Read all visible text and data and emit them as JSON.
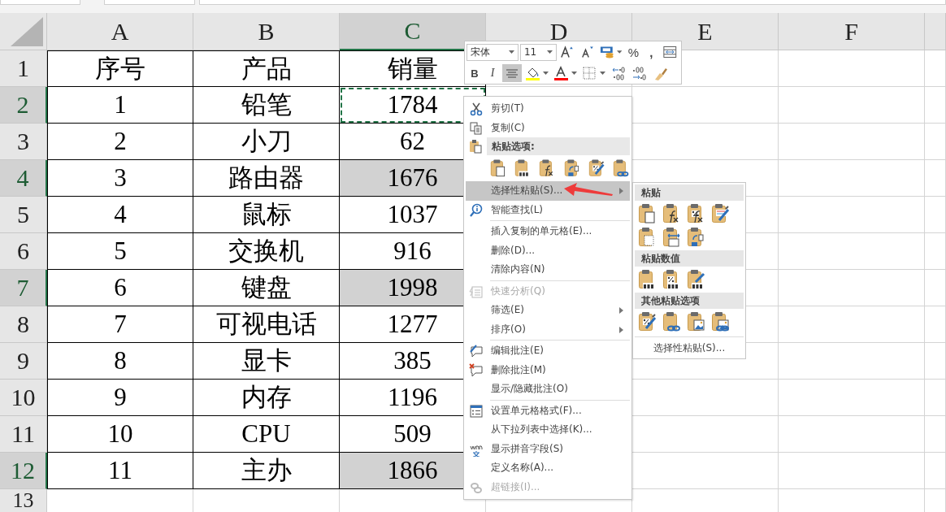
{
  "table": {
    "columns": [
      {
        "label": "A",
        "selected": false
      },
      {
        "label": "B",
        "selected": false
      },
      {
        "label": "C",
        "selected": true
      },
      {
        "label": "D",
        "selected": false
      },
      {
        "label": "E",
        "selected": false
      },
      {
        "label": "F",
        "selected": false
      }
    ],
    "rows": [
      {
        "header": "1",
        "selected": false,
        "cells": [
          {
            "text": "序号",
            "selected": false,
            "copied": false
          },
          {
            "text": "产品",
            "selected": false,
            "copied": false
          },
          {
            "text": "销量",
            "selected": false,
            "copied": false
          }
        ]
      },
      {
        "header": "2",
        "selected": true,
        "cells": [
          {
            "text": "1",
            "selected": false,
            "copied": false
          },
          {
            "text": "铅笔",
            "selected": false,
            "copied": false
          },
          {
            "text": "1784",
            "selected": false,
            "copied": true
          }
        ]
      },
      {
        "header": "3",
        "selected": false,
        "cells": [
          {
            "text": "2",
            "selected": false,
            "copied": false
          },
          {
            "text": "小刀",
            "selected": false,
            "copied": false
          },
          {
            "text": "62",
            "selected": false,
            "copied": false
          }
        ]
      },
      {
        "header": "4",
        "selected": true,
        "cells": [
          {
            "text": "3",
            "selected": false,
            "copied": false
          },
          {
            "text": "路由器",
            "selected": false,
            "copied": false
          },
          {
            "text": "1676",
            "selected": true,
            "copied": false
          }
        ]
      },
      {
        "header": "5",
        "selected": false,
        "cells": [
          {
            "text": "4",
            "selected": false,
            "copied": false
          },
          {
            "text": "鼠标",
            "selected": false,
            "copied": false
          },
          {
            "text": "1037",
            "selected": false,
            "copied": false
          }
        ]
      },
      {
        "header": "6",
        "selected": false,
        "cells": [
          {
            "text": "5",
            "selected": false,
            "copied": false
          },
          {
            "text": "交换机",
            "selected": false,
            "copied": false
          },
          {
            "text": "916",
            "selected": false,
            "copied": false
          }
        ]
      },
      {
        "header": "7",
        "selected": true,
        "cells": [
          {
            "text": "6",
            "selected": false,
            "copied": false
          },
          {
            "text": "键盘",
            "selected": false,
            "copied": false
          },
          {
            "text": "1998",
            "selected": true,
            "copied": false
          }
        ]
      },
      {
        "header": "8",
        "selected": false,
        "cells": [
          {
            "text": "7",
            "selected": false,
            "copied": false
          },
          {
            "text": "可视电话",
            "selected": false,
            "copied": false
          },
          {
            "text": "1277",
            "selected": false,
            "copied": false
          }
        ]
      },
      {
        "header": "9",
        "selected": false,
        "cells": [
          {
            "text": "8",
            "selected": false,
            "copied": false
          },
          {
            "text": "显卡",
            "selected": false,
            "copied": false
          },
          {
            "text": "385",
            "selected": false,
            "copied": false
          }
        ]
      },
      {
        "header": "10",
        "selected": false,
        "cells": [
          {
            "text": "9",
            "selected": false,
            "copied": false
          },
          {
            "text": "内存",
            "selected": false,
            "copied": false
          },
          {
            "text": "1196",
            "selected": false,
            "copied": false
          }
        ]
      },
      {
        "header": "11",
        "selected": false,
        "cells": [
          {
            "text": "10",
            "selected": false,
            "copied": false
          },
          {
            "text": "CPU",
            "selected": false,
            "copied": false
          },
          {
            "text": "509",
            "selected": false,
            "copied": false
          }
        ]
      },
      {
        "header": "12",
        "selected": true,
        "cells": [
          {
            "text": "11",
            "selected": false,
            "copied": false
          },
          {
            "text": "主办",
            "selected": false,
            "copied": false
          },
          {
            "text": "1866",
            "selected": true,
            "copied": false
          }
        ]
      },
      {
        "header": "13",
        "selected": false,
        "cells": []
      }
    ]
  },
  "mini_toolbar": {
    "font": "宋体",
    "size": "11",
    "row_1": [
      {
        "kind": "grow",
        "selected": false
      },
      {
        "kind": "shrink",
        "selected": false
      },
      {
        "kind": "accounting",
        "selected": false
      },
      {
        "kind": "percent",
        "label": "%",
        "selected": false
      },
      {
        "kind": "comma",
        "label": ",",
        "selected": false
      },
      {
        "kind": "merge",
        "selected": false
      }
    ],
    "row_2": [
      {
        "kind": "bold",
        "label": "B",
        "selected": false
      },
      {
        "kind": "italic",
        "label": "I",
        "selected": false
      },
      {
        "kind": "align",
        "selected": true
      },
      {
        "kind": "fill",
        "color": "#ffff00",
        "selected": false
      },
      {
        "kind": "fontcolor",
        "color": "#ff0000",
        "selected": false
      },
      {
        "kind": "borders",
        "selected": false
      },
      {
        "kind": "incdec",
        "selected": false
      },
      {
        "kind": "decdec",
        "selected": false
      },
      {
        "kind": "painter",
        "selected": false
      }
    ]
  },
  "context_menu": {
    "items": [
      {
        "kind": "item",
        "label": "剪切(T)",
        "selected": false,
        "disabled": false,
        "submenu": false
      },
      {
        "kind": "item",
        "label": "复制(C)",
        "selected": false,
        "disabled": false,
        "submenu": false
      },
      {
        "kind": "header",
        "label": "粘贴选项:"
      },
      {
        "kind": "icons",
        "icons": [
          {
            "kind": "paste"
          },
          {
            "kind": "values"
          },
          {
            "kind": "formulas"
          },
          {
            "kind": "transpose"
          },
          {
            "kind": "percent_brush"
          },
          {
            "kind": "link"
          }
        ]
      },
      {
        "kind": "item",
        "label": "选择性粘贴(S)...",
        "selected": true,
        "disabled": false,
        "submenu": true
      },
      {
        "kind": "item",
        "label": "智能查找(L)",
        "selected": false,
        "disabled": false,
        "submenu": false
      },
      {
        "kind": "separator"
      },
      {
        "kind": "item",
        "label": "插入复制的单元格(E)...",
        "selected": false,
        "disabled": false,
        "submenu": false
      },
      {
        "kind": "item",
        "label": "删除(D)...",
        "selected": false,
        "disabled": false,
        "submenu": false
      },
      {
        "kind": "item",
        "label": "清除内容(N)",
        "selected": false,
        "disabled": false,
        "submenu": false
      },
      {
        "kind": "separator"
      },
      {
        "kind": "item",
        "label": "快速分析(Q)",
        "selected": false,
        "disabled": true,
        "submenu": false
      },
      {
        "kind": "item",
        "label": "筛选(E)",
        "selected": false,
        "disabled": false,
        "submenu": true
      },
      {
        "kind": "item",
        "label": "排序(O)",
        "selected": false,
        "disabled": false,
        "submenu": true
      },
      {
        "kind": "separator"
      },
      {
        "kind": "item",
        "label": "编辑批注(E)",
        "selected": false,
        "disabled": false,
        "submenu": false
      },
      {
        "kind": "item",
        "label": "删除批注(M)",
        "selected": false,
        "disabled": false,
        "submenu": false
      },
      {
        "kind": "item",
        "label": "显示/隐藏批注(O)",
        "selected": false,
        "disabled": false,
        "submenu": false
      },
      {
        "kind": "separator"
      },
      {
        "kind": "item",
        "label": "设置单元格格式(F)...",
        "selected": false,
        "disabled": false,
        "submenu": false
      },
      {
        "kind": "item",
        "label": "从下拉列表中选择(K)...",
        "selected": false,
        "disabled": false,
        "submenu": false
      },
      {
        "kind": "item",
        "label": "显示拼音字段(S)",
        "selected": false,
        "disabled": false,
        "submenu": false
      },
      {
        "kind": "item",
        "label": "定义名称(A)...",
        "selected": false,
        "disabled": false,
        "submenu": false
      },
      {
        "kind": "item",
        "label": "超链接(I)...",
        "selected": false,
        "disabled": true,
        "submenu": false
      }
    ]
  },
  "submenu": {
    "sections": [
      {
        "title": "粘贴",
        "icons": [
          {
            "kind": "paste"
          },
          {
            "kind": "formulas"
          },
          {
            "kind": "formula_format"
          },
          {
            "kind": "format_brush"
          },
          {
            "kind": "no_border"
          },
          {
            "kind": "col_width"
          },
          {
            "kind": "transpose"
          }
        ]
      },
      {
        "title": "粘贴数值",
        "icons": [
          {
            "kind": "values"
          },
          {
            "kind": "values_percent"
          },
          {
            "kind": "values_brush"
          }
        ]
      },
      {
        "title": "其他粘贴选项",
        "icons": [
          {
            "kind": "percent_brush"
          },
          {
            "kind": "link"
          },
          {
            "kind": "picture"
          },
          {
            "kind": "linked_picture"
          }
        ]
      }
    ],
    "footer": "选择性粘贴(S)..."
  }
}
